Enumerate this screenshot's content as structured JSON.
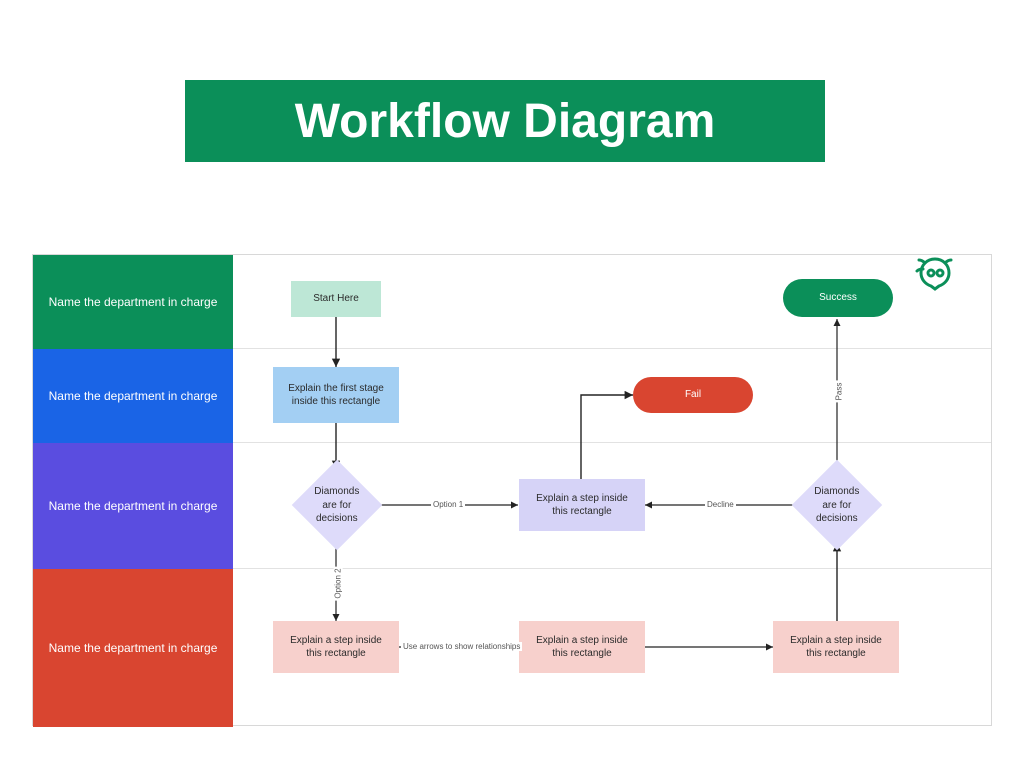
{
  "title": "Workflow Diagram",
  "lanes": {
    "l1": "Name the department in charge",
    "l2": "Name the department in charge",
    "l3": "Name the department in charge",
    "l4": "Name the department in charge"
  },
  "nodes": {
    "start": "Start Here",
    "stage1": "Explain the first stage inside this rectangle",
    "decision1": "Diamonds are for decisions",
    "decision2": "Diamonds are for decisions",
    "step_lav": "Explain a step inside this rectangle",
    "step_p1": "Explain a step inside this rectangle",
    "step_p2": "Explain a step inside this rectangle",
    "step_p3": "Explain a step inside this rectangle",
    "fail": "Fail",
    "success": "Success"
  },
  "edges": {
    "option1": "Option 1",
    "option2": "Option 2",
    "decline": "Decline",
    "pass": "Pass",
    "arrows_hint": "Use arrows to show relationships"
  },
  "colors": {
    "green": "#0b8f59",
    "blue": "#1a64e6",
    "purple": "#5a4de0",
    "red": "#d94530",
    "mint": "#bde7d6",
    "lightblue": "#a3cff3",
    "lavender": "#d6d3f7",
    "pink": "#f7d0cc",
    "lilac": "#dedbfa"
  }
}
